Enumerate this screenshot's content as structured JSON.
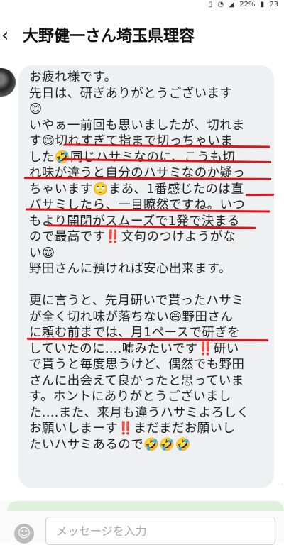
{
  "status_bar": {
    "icons": [
      "vibrate-icon",
      "wifi-icon",
      "signal-icon"
    ],
    "battery": "22%",
    "time": "23"
  },
  "header": {
    "back_icon": "back-arrow-icon",
    "contact_name": "大野健一さん埼玉県理容"
  },
  "message": {
    "lines": [
      "お疲れ様です。",
      "先日は、研ぎありがとうございます",
      "😊",
      "いやぁ一前回も思いましたが、切れま",
      "す😄切れすぎて指まで切っちゃいま",
      "した🤣同じハサミなのに、こうも切",
      "れ味が違うと自分のハサミなのか疑っ",
      "ちゃいます🙄まあ、1番感じたのは直",
      "バサミしたら、一目瞭然ですね。いつ",
      "もより開閉がスムーズで1発で決まる",
      "ので最高です‼️文句のつけようがな",
      "い😁",
      "野田さんに預ければ安心出来ます。",
      "",
      "更に言うと、先月研いで貰ったハサミ",
      "が全く切れ味が落ちない😄野田さん",
      "に頼む前までは、月1ペースで研ぎを",
      "していたのに....嘘みたいです‼️研い",
      "で貰うと毎度思うけど、偶然でも野田",
      "さんに出会えて良かったと思っていま",
      "す。ホントにありがとうございまし",
      "た....また、来月も違うハサミよろしく",
      "お願いしまーす‼️まだまだお願いし",
      "たいハサミあるので🤣🤣🤣"
    ],
    "underline_color": "#e0131b"
  },
  "composer": {
    "emoji_icon": "smiley-icon",
    "placeholder": "メッセージを入力"
  },
  "colors": {
    "bubble": "#eff0f2",
    "accent_green": "#dff1dc"
  }
}
